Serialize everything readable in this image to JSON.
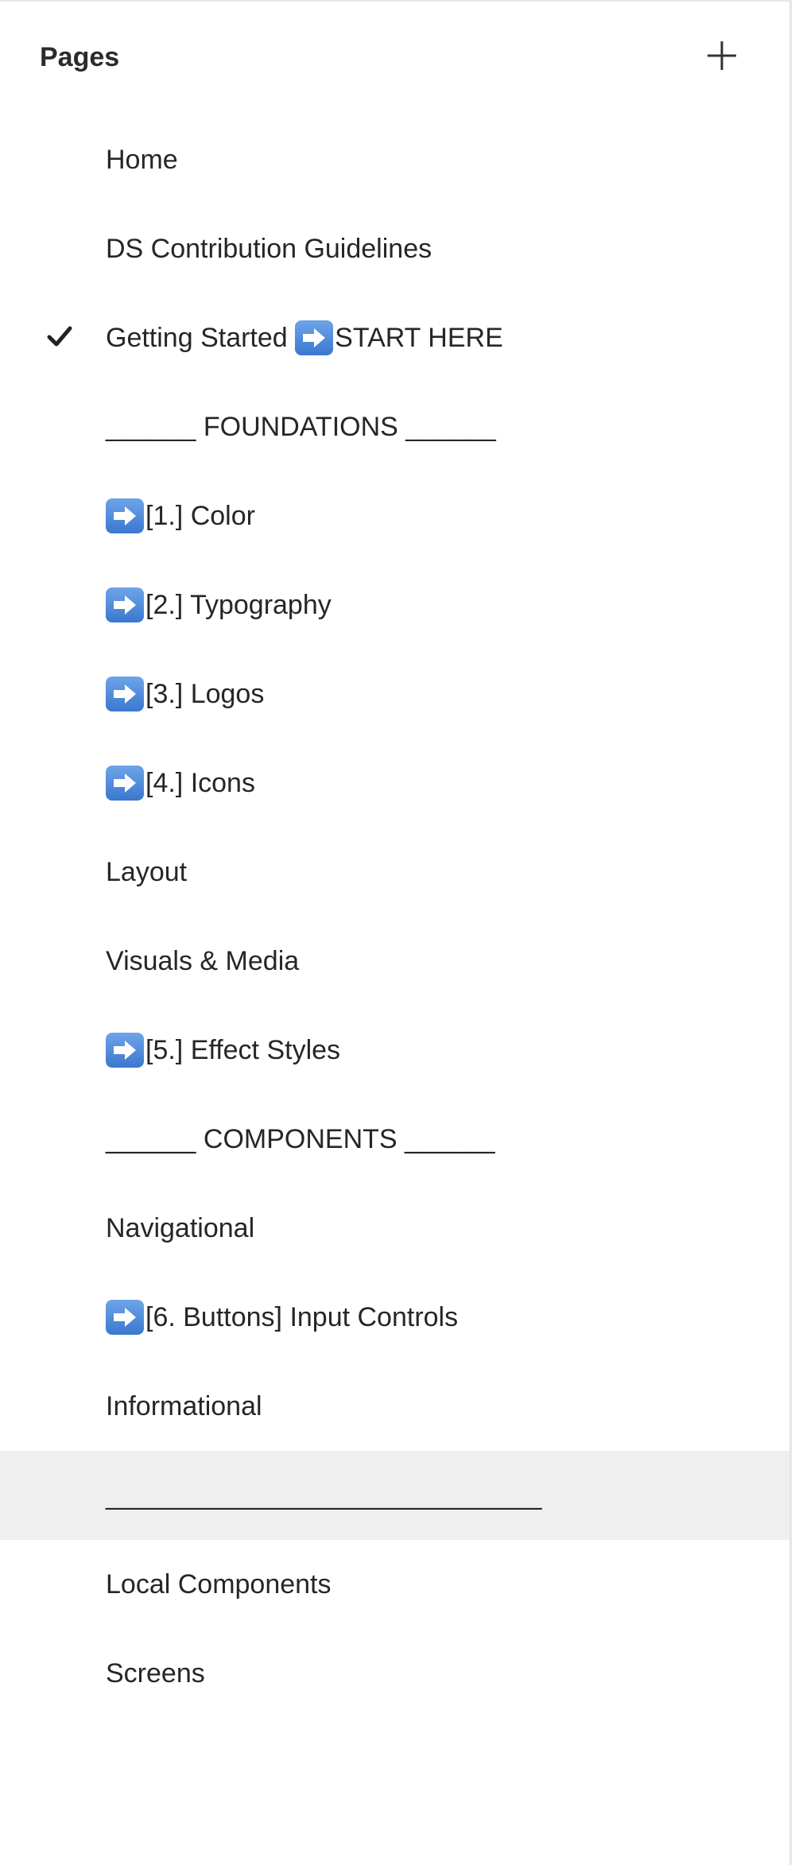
{
  "header": {
    "title": "Pages",
    "add_icon": "plus-icon"
  },
  "pages": [
    {
      "label": "Home",
      "arrow": false,
      "current": false
    },
    {
      "label": "DS Contribution Guidelines",
      "arrow": false,
      "current": false
    },
    {
      "prefix": "Getting Started ",
      "label": "START HERE",
      "arrow": true,
      "current": true
    },
    {
      "label": "______ FOUNDATIONS ______",
      "arrow": false,
      "current": false
    },
    {
      "label": "[1.] Color",
      "arrow": true,
      "current": false
    },
    {
      "label": "[2.] Typography",
      "arrow": true,
      "current": false
    },
    {
      "label": "[3.] Logos",
      "arrow": true,
      "current": false
    },
    {
      "label": "[4.] Icons",
      "arrow": true,
      "current": false
    },
    {
      "label": "Layout",
      "arrow": false,
      "current": false
    },
    {
      "label": "Visuals & Media",
      "arrow": false,
      "current": false
    },
    {
      "label": "[5.] Effect Styles",
      "arrow": true,
      "current": false
    },
    {
      "label": "______ COMPONENTS ______",
      "arrow": false,
      "current": false
    },
    {
      "label": "Navigational",
      "arrow": false,
      "current": false
    },
    {
      "label": "[6. Buttons] Input Controls",
      "arrow": true,
      "current": false
    },
    {
      "label": "Informational",
      "arrow": false,
      "current": false
    },
    {
      "label": "_____________________________",
      "arrow": false,
      "current": false,
      "hovered": true
    },
    {
      "label": "Local Components",
      "arrow": false,
      "current": false
    },
    {
      "label": "Screens",
      "arrow": false,
      "current": false
    }
  ],
  "icons": {
    "check": "checkmark-icon",
    "arrow": "right-arrow-emoji-icon"
  },
  "colors": {
    "hover_background": "#efefef",
    "arrow_emoji": "#4a86d8",
    "text": "#262626"
  }
}
